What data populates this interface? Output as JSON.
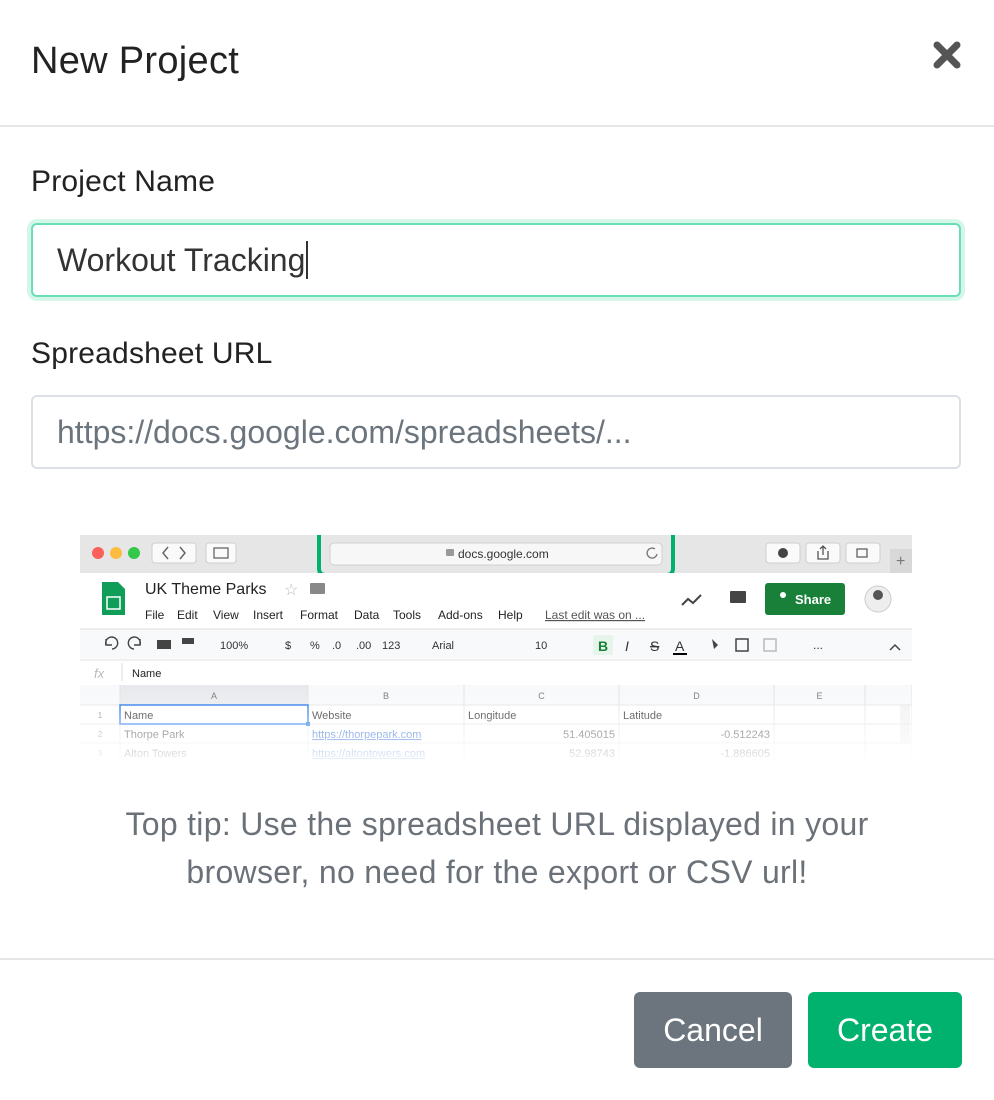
{
  "modal": {
    "title": "New Project",
    "project_name_label": "Project Name",
    "project_name_value": "Workout Tracking",
    "spreadsheet_url_label": "Spreadsheet URL",
    "spreadsheet_url_placeholder": "https://docs.google.com/spreadsheets/...",
    "tip": "Top tip: Use the spreadsheet URL displayed in your browser, no need for the export or CSV url!",
    "cancel_label": "Cancel",
    "create_label": "Create"
  },
  "screenshot": {
    "address": "docs.google.com",
    "doc_title": "UK Theme Parks",
    "menu": [
      "File",
      "Edit",
      "View",
      "Insert",
      "Format",
      "Data",
      "Tools",
      "Add-ons",
      "Help"
    ],
    "last_edit": "Last edit was on ...",
    "share_label": "Share",
    "toolbar": {
      "zoom": "100%",
      "currency": "$",
      "percent": "%",
      "dec_less": ".0",
      "dec_more": ".00",
      "number_format": "123",
      "font": "Arial",
      "font_size": "10",
      "bold": "B",
      "italic": "I",
      "strike": "S",
      "text_color": "A",
      "more": "..."
    },
    "fx_label": "fx",
    "formula_value": "Name",
    "columns": [
      "A",
      "B",
      "C",
      "D",
      "E"
    ],
    "rows": [
      {
        "num": "1",
        "cells": [
          "Name",
          "Website",
          "Longitude",
          "Latitude",
          ""
        ]
      },
      {
        "num": "2",
        "cells": [
          "Thorpe Park",
          "https://thorpepark.com",
          "51.405015",
          "-0.512243",
          ""
        ]
      },
      {
        "num": "3",
        "cells": [
          "Alton Towers",
          "https://altontowers.com",
          "52.98743",
          "-1.886605",
          ""
        ]
      }
    ]
  },
  "colors": {
    "accent": "#00b26e",
    "focus_ring": "#66e1b6",
    "highlight": "#00b26e",
    "cancel": "#6c757d"
  }
}
